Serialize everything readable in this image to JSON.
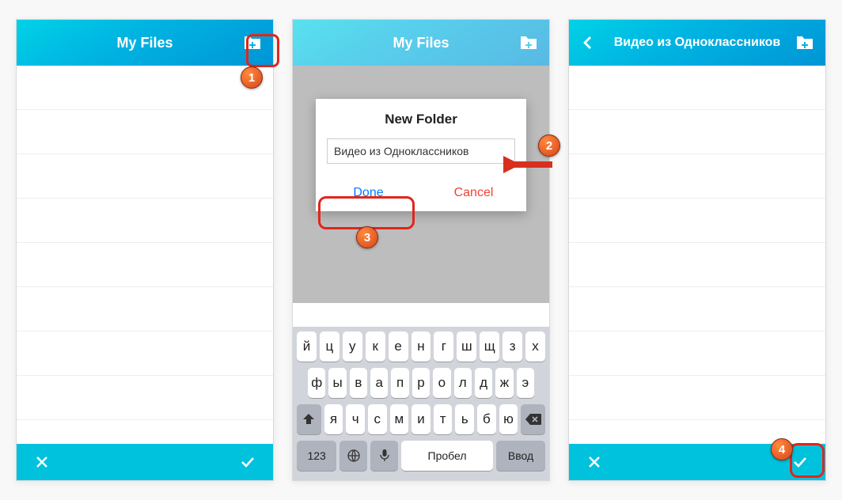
{
  "screens": {
    "s1": {
      "title": "My Files"
    },
    "s2": {
      "title": "My Files"
    },
    "s3": {
      "title": "Видео из Одноклассников"
    }
  },
  "dialog": {
    "title": "New Folder",
    "input_value": "Видео из Одноклассников",
    "done": "Done",
    "cancel": "Cancel"
  },
  "keyboard": {
    "row1": [
      "й",
      "ц",
      "у",
      "к",
      "е",
      "н",
      "г",
      "ш",
      "щ",
      "з",
      "х"
    ],
    "row2": [
      "ф",
      "ы",
      "в",
      "а",
      "п",
      "р",
      "о",
      "л",
      "д",
      "ж",
      "э"
    ],
    "row3": [
      "я",
      "ч",
      "с",
      "м",
      "и",
      "т",
      "ь",
      "б",
      "ю"
    ],
    "num": "123",
    "space": "Пробел",
    "enter": "Ввод"
  },
  "callouts": {
    "b1": "1",
    "b2": "2",
    "b3": "3",
    "b4": "4"
  }
}
